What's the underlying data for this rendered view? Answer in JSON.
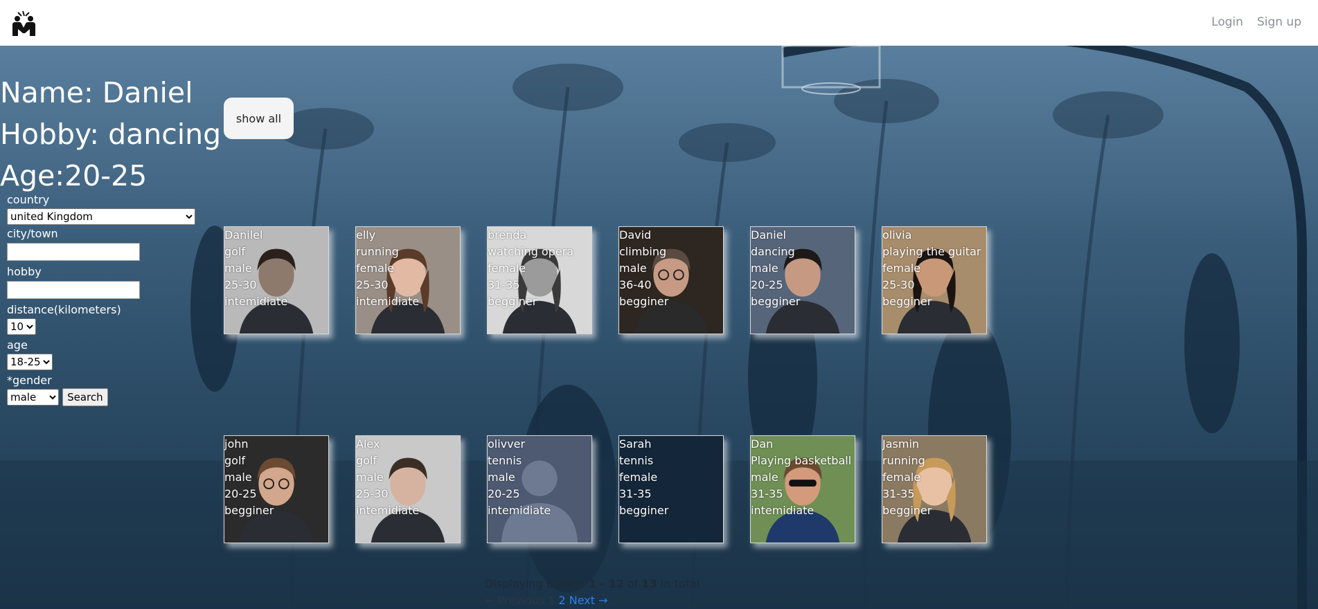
{
  "nav": {
    "login": "Login",
    "signup": "Sign up"
  },
  "profile": {
    "name": "Name: Daniel",
    "hobby": "Hobby: dancing",
    "age": "Age:20-25"
  },
  "show_all_label": "show all",
  "filter": {
    "country_label": "country",
    "country_value": "united Kingdom",
    "city_label": "city/town",
    "city_value": "",
    "hobby_label": "hobby",
    "hobby_value": "",
    "distance_label": "distance(kilometers)",
    "distance_value": "10",
    "age_label": "age",
    "age_value": "18-25",
    "gender_label": "*gender",
    "gender_value": "male",
    "search_label": "Search"
  },
  "buddies": [
    {
      "name": "Danilel",
      "hobby": "golf",
      "gender": "male",
      "age": "25-30",
      "level": "intemidiate",
      "photo": "man-beard-bw",
      "bg": "#b9b9b9",
      "skin": "#8d7a6d",
      "hair": "#2b211c"
    },
    {
      "name": "elly",
      "hobby": "running",
      "gender": "female",
      "age": "25-30",
      "level": "intemidiate",
      "photo": "woman-smile",
      "bg": "#9a8f86",
      "skin": "#e2b9a3",
      "hair": "#5b3b2a"
    },
    {
      "name": "brenda",
      "hobby": "watching opera",
      "gender": "female",
      "age": "31-35",
      "level": "begginer",
      "photo": "woman-curly-bw",
      "bg": "#d8d8d8",
      "skin": "#9b9b9b",
      "hair": "#3a3a3a"
    },
    {
      "name": "David",
      "hobby": "climbing",
      "gender": "male",
      "age": "36-40",
      "level": "begginer",
      "photo": "man-suit",
      "bg": "#2d2621",
      "skin": "#c79a84",
      "hair": "#5a4a3f"
    },
    {
      "name": "Daniel",
      "hobby": "dancing",
      "gender": "male",
      "age": "20-25",
      "level": "begginer",
      "photo": "man-curly",
      "bg": "#56657a",
      "skin": "#c69a82",
      "hair": "#1e1a18"
    },
    {
      "name": "olivia",
      "hobby": "playing the guitar",
      "gender": "female",
      "age": "25-30",
      "level": "begginer",
      "photo": "woman-long-hair",
      "bg": "#a88d6c",
      "skin": "#c99879",
      "hair": "#1b1512"
    },
    {
      "name": "john",
      "hobby": "golf",
      "gender": "male",
      "age": "20-25",
      "level": "begginer",
      "photo": "man-glasses",
      "bg": "#2b2b2b",
      "skin": "#d3a78c",
      "hair": "#6b4a32"
    },
    {
      "name": "Alex",
      "hobby": "golf",
      "gender": "male",
      "age": "25-30",
      "level": "intemidiate",
      "photo": "man-short-hair",
      "bg": "#c9c9c9",
      "skin": "#d6b3a0",
      "hair": "#3a2e26"
    },
    {
      "name": "olivver",
      "hobby": "tennis",
      "gender": "male",
      "age": "20-25",
      "level": "intemidiate",
      "photo": "default-avatar",
      "bg": "#4d5a72",
      "skin": "#6b7890",
      "hair": "#6b7890"
    },
    {
      "name": "Sarah",
      "hobby": "tennis",
      "gender": "female",
      "age": "31-35",
      "level": "begginer",
      "photo": "none",
      "bg": "#13263a",
      "skin": "#13263a",
      "hair": "#13263a"
    },
    {
      "name": "Dan",
      "hobby": "Playing basketball",
      "gender": "male",
      "age": "31-35",
      "level": "intemidiate",
      "photo": "man-sunglasses",
      "bg": "#6f8f55",
      "skin": "#d39a7c",
      "hair": "#6a4a30"
    },
    {
      "name": "Jasmin",
      "hobby": "running",
      "gender": "female",
      "age": "31-35",
      "level": "begginer",
      "photo": "woman-blonde",
      "bg": "#8b7a62",
      "skin": "#e8c1a4",
      "hair": "#c79a5a"
    }
  ],
  "pagination": {
    "prefix": "Displaying Buddie ",
    "range": "1 - 12",
    "of": " of ",
    "total": "13",
    "suffix": " in total",
    "previous": "← Previous",
    "page1": "1",
    "page2": "2",
    "next": "Next →"
  }
}
